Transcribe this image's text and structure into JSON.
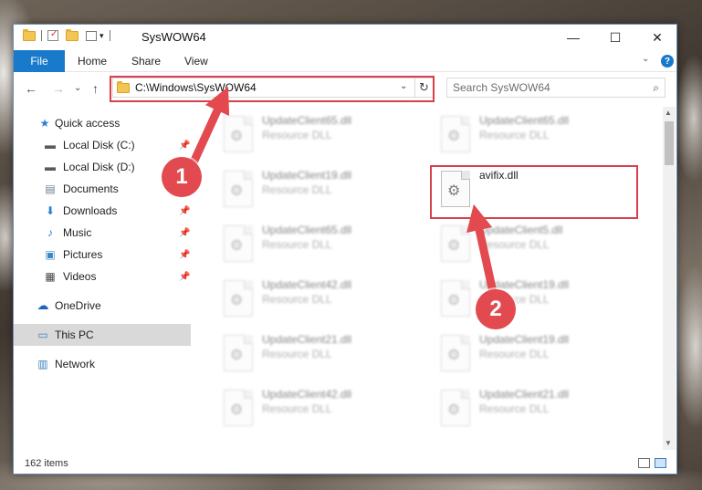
{
  "window": {
    "title": "SysWOW64",
    "controls": {
      "minimize": "—",
      "maximize": "☐",
      "close": "✕"
    }
  },
  "quick_access_toolbar": {
    "dropdown_glyph": "▾"
  },
  "ribbon": {
    "tabs": [
      "File",
      "Home",
      "Share",
      "View"
    ],
    "help": "?",
    "collapse": "⌄"
  },
  "nav": {
    "back": "←",
    "forward": "→",
    "recent": "⌄",
    "up": "↑",
    "address_path": "C:\\Windows\\SysWOW64",
    "address_dropdown": "⌄",
    "refresh": "↻",
    "search_placeholder": "Search SysWOW64",
    "search_icon": "⌕"
  },
  "sidebar": {
    "items": [
      {
        "label": "Quick access",
        "icon": "star-icon",
        "glyph": "★",
        "color": "#2a7fd4",
        "pinned": false
      },
      {
        "label": "Local Disk (C:)",
        "icon": "drive-icon",
        "glyph": "▬",
        "color": "#5a5a5a",
        "pinned": true
      },
      {
        "label": "Local Disk (D:)",
        "icon": "drive-icon",
        "glyph": "▬",
        "color": "#5a5a5a",
        "pinned": true
      },
      {
        "label": "Documents",
        "icon": "documents-icon",
        "glyph": "▤",
        "color": "#6b7c93",
        "pinned": true
      },
      {
        "label": "Downloads",
        "icon": "downloads-icon",
        "glyph": "⬇",
        "color": "#2a7fd4",
        "pinned": true
      },
      {
        "label": "Music",
        "icon": "music-icon",
        "glyph": "♪",
        "color": "#2a7fd4",
        "pinned": true
      },
      {
        "label": "Pictures",
        "icon": "pictures-icon",
        "glyph": "▣",
        "color": "#3a88c7",
        "pinned": true
      },
      {
        "label": "Videos",
        "icon": "videos-icon",
        "glyph": "▦",
        "color": "#4a4a4a",
        "pinned": true
      },
      {
        "label": "OneDrive",
        "icon": "onedrive-icon",
        "glyph": "☁",
        "color": "#1e64b8",
        "pinned": false
      },
      {
        "label": "This PC",
        "icon": "computer-icon",
        "glyph": "▭",
        "color": "#3a7fbf",
        "pinned": false,
        "selected": true
      },
      {
        "label": "Network",
        "icon": "network-icon",
        "glyph": "▥",
        "color": "#3a7fbf",
        "pinned": false
      }
    ],
    "pin_glyph": "📌"
  },
  "files": {
    "left_column": [
      {
        "name": "UpdateClient65.dll",
        "type": "Resource DLL"
      },
      {
        "name": "UpdateClient19.dll",
        "type": "Resource DLL"
      },
      {
        "name": "UpdateClient65.dll",
        "type": "Resource DLL"
      },
      {
        "name": "UpdateClient42.dll",
        "type": "Resource DLL"
      },
      {
        "name": "UpdateClient21.dll",
        "type": "Resource DLL"
      },
      {
        "name": "UpdateClient42.dll",
        "type": "Resource DLL"
      }
    ],
    "right_column": [
      {
        "name": "UpdateClient65.dll",
        "type": "Resource DLL"
      },
      {
        "name": "avifix.dll",
        "type": "",
        "highlighted": true
      },
      {
        "name": "UpdateClient5.dll",
        "type": "Resource DLL"
      },
      {
        "name": "UpdateClient19.dll",
        "type": "Resource DLL"
      },
      {
        "name": "UpdateClient19.dll",
        "type": "Resource DLL"
      },
      {
        "name": "UpdateClient21.dll",
        "type": "Resource DLL"
      }
    ],
    "gear_glyph": "⚙"
  },
  "scrollbar": {
    "up": "▲",
    "down": "▼"
  },
  "status": {
    "item_count": "162 items"
  },
  "annotations": {
    "marker_1": "1",
    "marker_2": "2",
    "color": "#d8404a"
  }
}
